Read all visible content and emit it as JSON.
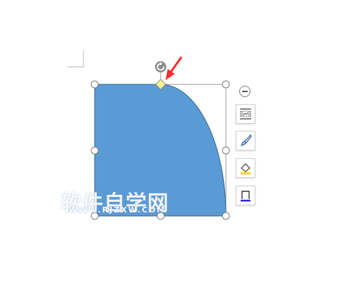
{
  "shape": {
    "fill_color": "#5b9bd5",
    "outline_color": "#41719c",
    "kind": "rounded-corner-rectangle"
  },
  "handles": {
    "adjust_color": "#fff38a",
    "rotate_icon": "rotate-icon"
  },
  "annotation": {
    "arrow_color": "#ff2a2a"
  },
  "side_toolbar": {
    "collapse_icon": "minus-circle-icon",
    "buttons": [
      {
        "icon": "layout-options-icon"
      },
      {
        "icon": "brush-icon"
      },
      {
        "icon": "fill-bucket-icon"
      },
      {
        "icon": "outline-box-icon"
      }
    ]
  },
  "watermark": {
    "title": "软件自学网",
    "url": "WWW.RJZXW.COM"
  }
}
